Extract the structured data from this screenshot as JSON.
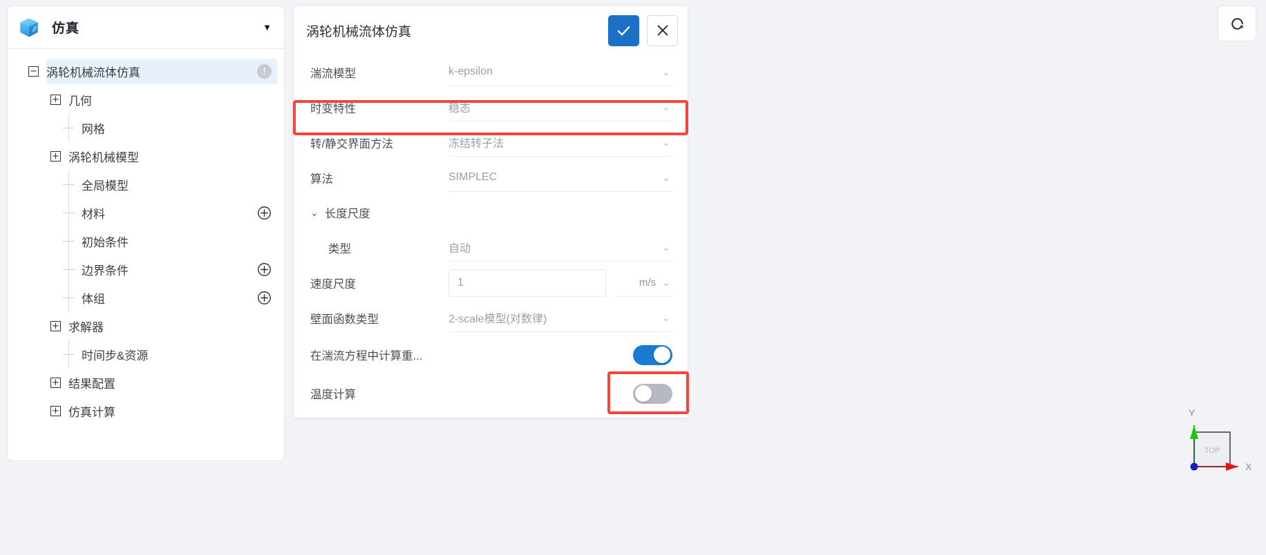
{
  "app": {
    "title": "仿真",
    "logo_icon": "cube-logo-icon",
    "caret_icon": "chevron-down-icon"
  },
  "sidebar": {
    "tree": [
      {
        "label": "涡轮机械流体仿真",
        "toggle": "−",
        "level": 0,
        "selected": true,
        "action": "info-badge",
        "action_glyph": "!"
      },
      {
        "label": "几何",
        "toggle": "+",
        "level": 1,
        "selected": false,
        "action": "none"
      },
      {
        "label": "网格",
        "toggle": "",
        "level": 2,
        "selected": false,
        "action": "none"
      },
      {
        "label": "涡轮机械模型",
        "toggle": "+",
        "level": 1,
        "selected": false,
        "action": "none"
      },
      {
        "label": "全局模型",
        "toggle": "",
        "level": 2,
        "selected": false,
        "action": "none"
      },
      {
        "label": "材料",
        "toggle": "",
        "level": 2,
        "selected": false,
        "action": "add-circle",
        "action_glyph": "+"
      },
      {
        "label": "初始条件",
        "toggle": "",
        "level": 2,
        "selected": false,
        "action": "none"
      },
      {
        "label": "边界条件",
        "toggle": "",
        "level": 2,
        "selected": false,
        "action": "add-circle",
        "action_glyph": "+"
      },
      {
        "label": "体组",
        "toggle": "",
        "level": 2,
        "selected": false,
        "action": "add-circle",
        "action_glyph": "+"
      },
      {
        "label": "求解器",
        "toggle": "+",
        "level": 1,
        "selected": false,
        "action": "none"
      },
      {
        "label": "时间步&资源",
        "toggle": "",
        "level": 2,
        "selected": false,
        "action": "none"
      },
      {
        "label": "结果配置",
        "toggle": "+",
        "level": 1,
        "selected": false,
        "action": "none"
      },
      {
        "label": "仿真计算",
        "toggle": "+",
        "level": 1,
        "selected": false,
        "action": "none"
      }
    ]
  },
  "panel": {
    "title": "涡轮机械流体仿真",
    "confirm_label": "✓",
    "cancel_label": "✕",
    "rows": [
      {
        "kind": "select",
        "label": "湍流模型",
        "value": "k-epsilon",
        "indent": 0,
        "highlight": false
      },
      {
        "kind": "select",
        "label": "时变特性",
        "value": "稳态",
        "indent": 0,
        "highlight": true
      },
      {
        "kind": "select",
        "label": "转/静交界面方法",
        "value": "冻结转子法",
        "indent": 0,
        "highlight": false
      },
      {
        "kind": "select",
        "label": "算法",
        "value": "SIMPLEC",
        "indent": 0,
        "highlight": false
      },
      {
        "kind": "group",
        "label": "长度尺度",
        "value": "",
        "indent": 0,
        "highlight": false
      },
      {
        "kind": "select",
        "label": "类型",
        "value": "自动",
        "indent": 1,
        "highlight": false
      },
      {
        "kind": "input",
        "label": "速度尺度",
        "value": "1",
        "unit": "m/s",
        "indent": 0,
        "highlight": false
      },
      {
        "kind": "select",
        "label": "壁面函数类型",
        "value": "2-scale模型(对数律)",
        "indent": 0,
        "highlight": false
      },
      {
        "kind": "toggle",
        "label": "在湍流方程中计算重...",
        "value": "on",
        "indent": 0,
        "highlight": false
      },
      {
        "kind": "toggle",
        "label": "温度计算",
        "value": "off",
        "indent": 0,
        "highlight": true
      }
    ]
  },
  "toolbar": {
    "refresh_icon": "rotate-refresh-icon"
  },
  "viewport": {
    "axis": {
      "x_label": "X",
      "y_label": "Y",
      "face_label": "TOP",
      "x_color": "#d40f0f",
      "y_color": "#0fb80f",
      "origin_color": "#1420c8"
    }
  },
  "colors": {
    "accent": "#1b7ad1",
    "highlight": "#f5453a",
    "selected_row": "#e8f0fa",
    "page_bg": "#f1f3f7"
  }
}
